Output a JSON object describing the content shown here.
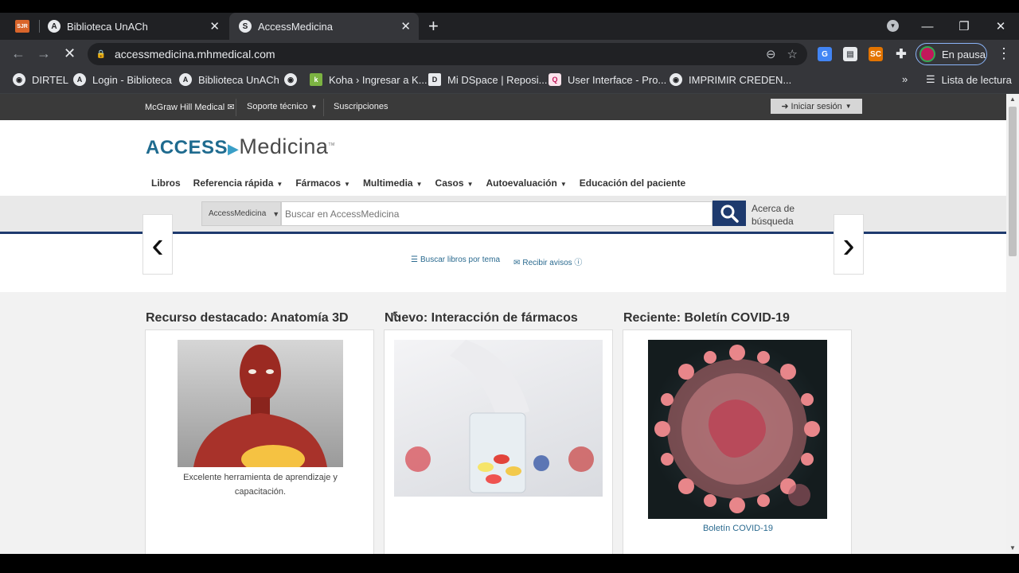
{
  "browser": {
    "tabs": [
      {
        "favicon": "SJR",
        "title": ""
      },
      {
        "favicon": "A",
        "title": "Biblioteca UnACh"
      },
      {
        "favicon": "S",
        "title": "AccessMedicina"
      }
    ],
    "url": "accessmedicina.mhmedical.com",
    "profile_label": "En pausa",
    "bookmarks": [
      {
        "label": "DIRTEL"
      },
      {
        "label": "Login - Biblioteca"
      },
      {
        "label": "Biblioteca UnACh"
      },
      {
        "label": ""
      },
      {
        "label": "Koha › Ingresar a K..."
      },
      {
        "label": "Mi DSpace | Reposi..."
      },
      {
        "label": "User Interface - Pro..."
      },
      {
        "label": "IMPRIMIR CREDEN..."
      }
    ],
    "overflow": "»",
    "reading_list": "Lista de lectura"
  },
  "utility": {
    "mcgraw": "McGraw Hill Medical",
    "support": "Soporte técnico",
    "subscriptions": "Suscripciones",
    "signin": "Iniciar sesión"
  },
  "site": {
    "logo_access": "ACCESS",
    "logo_medicina": "Medicina",
    "logo_tm": "TM",
    "nav": [
      {
        "label": "Libros"
      },
      {
        "label": "Referencia rápida"
      },
      {
        "label": "Fármacos"
      },
      {
        "label": "Multimedia"
      },
      {
        "label": "Casos"
      },
      {
        "label": "Autoevaluación"
      },
      {
        "label": "Educación del paciente"
      }
    ]
  },
  "search": {
    "scope": "AccessMedicina",
    "placeholder": "Buscar en AccessMedicina",
    "about_line1": "Acerca de",
    "about_line2": "búsqueda"
  },
  "sublinks": {
    "browse": "Buscar libros por tema",
    "alerts": "Recibir avisos"
  },
  "carousel": {
    "prev": "‹",
    "next": "›"
  },
  "sections": [
    {
      "title": "Recurso destacado: Anatomía 3D",
      "caption": "Excelente herramienta de aprendizaje y capacitación."
    },
    {
      "title": "Nuevo: Interacción de fármacos",
      "caption": ""
    },
    {
      "title": "Reciente: Boletín COVID-19",
      "caption": "Boletín COVID-19"
    }
  ],
  "colors": {
    "navy": "#1e3a6e",
    "link": "#2a6a8f",
    "logo_blue": "#1f6b8f"
  }
}
